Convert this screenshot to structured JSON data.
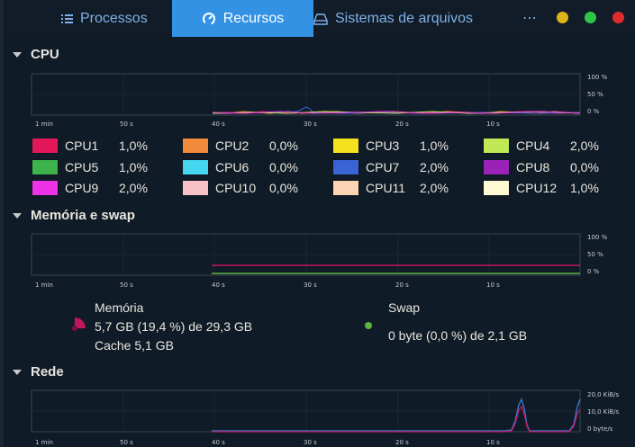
{
  "tabs": [
    {
      "label": "Processos",
      "icon": "list-icon"
    },
    {
      "label": "Recursos",
      "icon": "gauge-icon",
      "active": true
    },
    {
      "label": "Sistemas de arquivos",
      "icon": "drive-icon"
    }
  ],
  "menu": {
    "label": "⋯"
  },
  "window_controls": {
    "minimize_color": "#e0b418",
    "maximize_color": "#2fc448",
    "close_color": "#e02b2b"
  },
  "cpu": {
    "title": "CPU",
    "x_ticks": [
      "1 min",
      "50 s",
      "40 s",
      "30 s",
      "20 s",
      "10 s"
    ],
    "y_ticks": [
      "100 %",
      "50 %",
      "0 %"
    ],
    "cores": [
      {
        "name": "CPU1",
        "value": "1,0%",
        "color": "#e2185a"
      },
      {
        "name": "CPU2",
        "value": "0,0%",
        "color": "#f28a3c"
      },
      {
        "name": "CPU3",
        "value": "1,0%",
        "color": "#f5e11e"
      },
      {
        "name": "CPU4",
        "value": "2,0%",
        "color": "#c0ea55"
      },
      {
        "name": "CPU5",
        "value": "1,0%",
        "color": "#3cb44b"
      },
      {
        "name": "CPU6",
        "value": "0,0%",
        "color": "#46d7f0"
      },
      {
        "name": "CPU7",
        "value": "2,0%",
        "color": "#3a63d6"
      },
      {
        "name": "CPU8",
        "value": "0,0%",
        "color": "#9a22b8"
      },
      {
        "name": "CPU9",
        "value": "2,0%",
        "color": "#ee32e6"
      },
      {
        "name": "CPU10",
        "value": "0,0%",
        "color": "#f9c2c6"
      },
      {
        "name": "CPU11",
        "value": "2,0%",
        "color": "#fbd4b4"
      },
      {
        "name": "CPU12",
        "value": "1,0%",
        "color": "#fef9d2"
      }
    ]
  },
  "memory": {
    "title": "Memória e swap",
    "x_ticks": [
      "1 min",
      "50 s",
      "40 s",
      "30 s",
      "20 s",
      "10 s"
    ],
    "y_ticks": [
      "100 %",
      "50 %",
      "0 %"
    ],
    "mem_label": "Memória",
    "mem_value": "5,7 GB (19,4 %) de 29,3 GB",
    "cache": "Cache 5,1 GB",
    "mem_color": "#c2185b",
    "swap_label": "Swap",
    "swap_value": "0 byte (0,0 %) de 2,1 GB",
    "swap_color": "#5cb43a"
  },
  "network": {
    "title": "Rede",
    "x_ticks": [
      "1 min",
      "50 s",
      "40 s",
      "30 s",
      "20 s",
      "10 s"
    ],
    "y_ticks": [
      "20,0 KiB/s",
      "10,0 KiB/s",
      "0 byte/s"
    ]
  }
}
